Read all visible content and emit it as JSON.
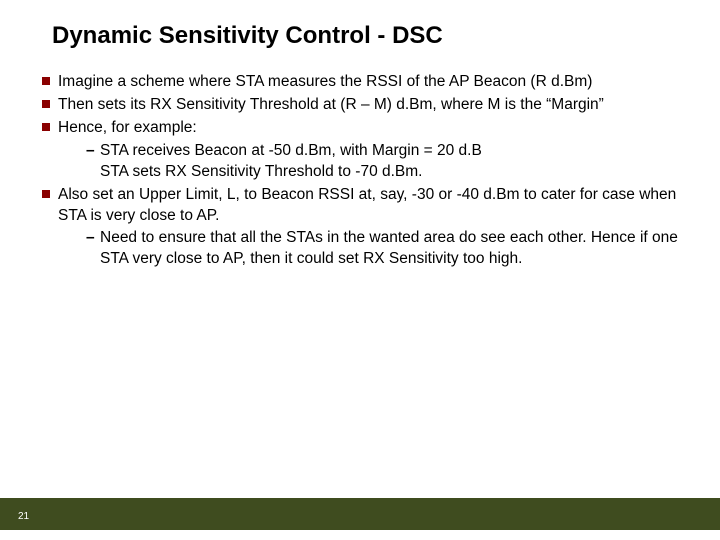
{
  "title": "Dynamic Sensitivity Control - DSC",
  "bullets": [
    {
      "text": "Imagine a scheme where STA measures the RSSI of the AP Beacon (R d.Bm)"
    },
    {
      "text": "Then sets its RX Sensitivity Threshold at (R – M) d.Bm, where M is the “Margin”"
    },
    {
      "text": "Hence, for example:",
      "sub": [
        {
          "text": "STA receives Beacon at -50 d.Bm, with Margin = 20 d.B",
          "extra": "STA sets RX Sensitivity Threshold to -70 d.Bm."
        }
      ]
    },
    {
      "text": "Also set an Upper Limit, L, to Beacon RSSI at, say, -30 or  -40 d.Bm to cater for case when STA is very close to AP.",
      "sub": [
        {
          "text": "Need to ensure that all the STAs in the wanted area do see each other.  Hence if one STA very close to AP, then it could set RX Sensitivity too high."
        }
      ]
    }
  ],
  "slide_number": "21",
  "colors": {
    "accent_red": "#8a0000",
    "footer_green": "#3f4c1f"
  }
}
